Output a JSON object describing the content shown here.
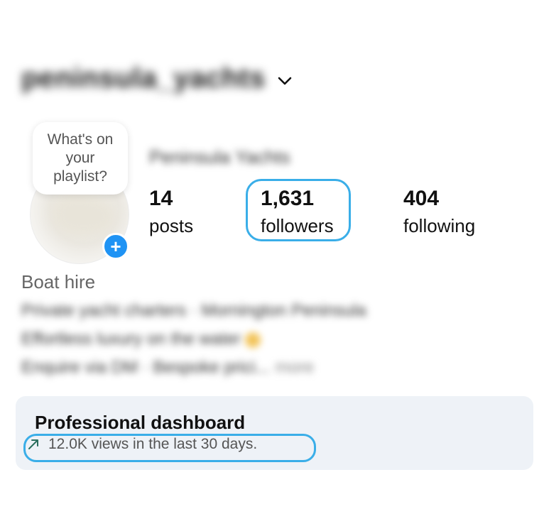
{
  "header": {
    "username": "peninsula_yachts",
    "chevron_icon": "chevron-down-icon"
  },
  "profile": {
    "note_text": "What's on your playlist?",
    "display_name": "Peninsula Yachts",
    "add_icon": "plus-icon"
  },
  "stats": {
    "posts_value": "14",
    "posts_label": "posts",
    "followers_value": "1,631",
    "followers_label": "followers",
    "following_value": "404",
    "following_label": "following"
  },
  "bio": {
    "category": "Boat hire",
    "line1": "Private yacht charters · Mornington Peninsula",
    "line2": "Effortless luxury on the water",
    "line3": "Enquire via DM · Bespoke prici...",
    "more": "more"
  },
  "dashboard": {
    "title": "Professional dashboard",
    "subtitle": "12.0K views in the last 30 days.",
    "arrow_icon": "trend-up-arrow-icon"
  },
  "colors": {
    "accent_blue": "#1f93f4",
    "highlight_outline": "#3aaee8",
    "dashboard_bg": "#eef2f7"
  }
}
